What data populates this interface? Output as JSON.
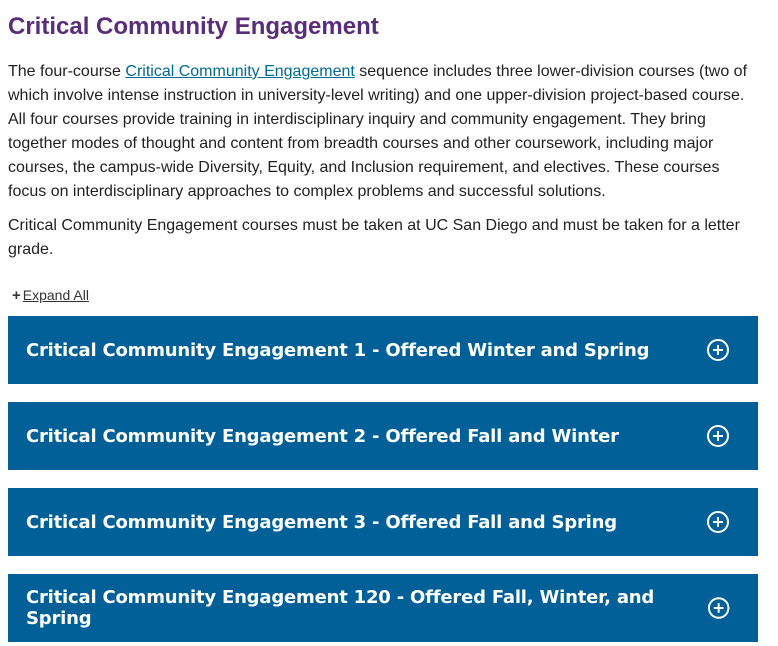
{
  "page": {
    "title": "Critical Community Engagement"
  },
  "intro": {
    "text_before_link": "The four-course ",
    "link_text": "Critical Community Engagement",
    "text_after_link": " sequence includes three lower-division courses (two of which involve intense instruction in university-level writing) and one upper-division project-based course. All four courses provide training in interdisciplinary inquiry and community engagement. They bring together modes of thought and content from breadth courses and other coursework, including major courses, the campus-wide Diversity, Equity, and Inclusion requirement, and electives. These courses focus on interdisciplinary approaches to complex problems and successful solutions."
  },
  "note": {
    "text": "Critical Community Engagement courses must be taken at UC San Diego and must be taken for a letter grade."
  },
  "expand": {
    "icon": "+",
    "label": "Expand All"
  },
  "accordion": {
    "items": [
      {
        "title": "Critical Community Engagement 1 - Offered Winter and Spring",
        "icon": "plus-circle-icon"
      },
      {
        "title": "Critical Community Engagement 2 - Offered Fall and Winter",
        "icon": "plus-circle-icon"
      },
      {
        "title": "Critical Community Engagement 3 - Offered Fall and Spring",
        "icon": "plus-circle-icon"
      },
      {
        "title": "Critical Community Engagement 120 - Offered Fall, Winter, and Spring",
        "icon": "plus-circle-icon"
      }
    ]
  },
  "colors": {
    "heading": "#5a2d7a",
    "link": "#006a96",
    "accordion_bg": "#006097",
    "accordion_text": "#ffffff"
  }
}
